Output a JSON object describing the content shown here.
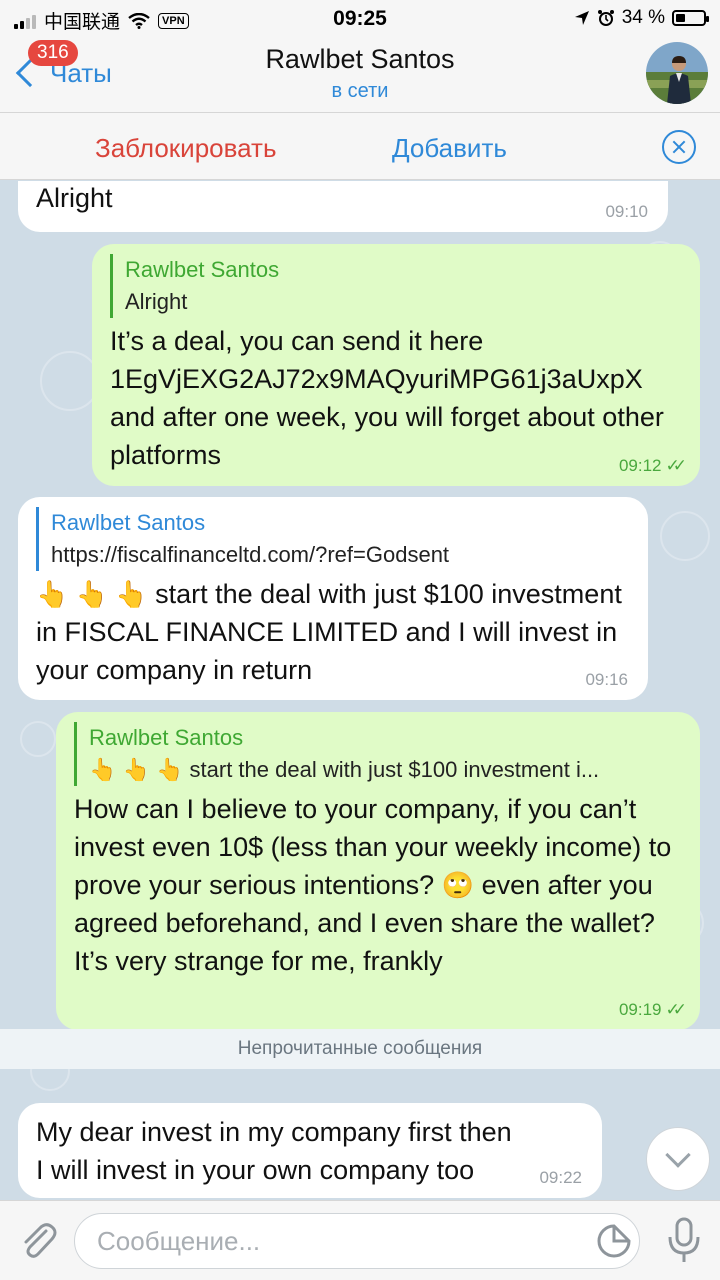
{
  "status_bar": {
    "carrier": "中国联通",
    "vpn": "VPN",
    "time": "09:25",
    "battery": "34 %",
    "battery_level": 0.34
  },
  "header": {
    "back_label": "Чаты",
    "unread_badge": "316",
    "title": "Rawlbet Santos",
    "subtitle": "в сети"
  },
  "actions": {
    "block": "Заблокировать",
    "add": "Добавить"
  },
  "messages": [
    {
      "direction": "in",
      "text": "Alright",
      "time": "09:10"
    },
    {
      "direction": "out",
      "reply_name": "Rawlbet Santos",
      "reply_text": "Alright",
      "text": "It’s a deal, you can send it here 1EgVjEXG2AJ72x9MAQyuriMPG61j3aUxpX and after one week, you will forget about other platforms",
      "time": "09:12"
    },
    {
      "direction": "in",
      "reply_name": "Rawlbet Santos",
      "reply_text": "https://fiscalfinanceltd.com/?ref=Godsent",
      "emoji": "👆 👆 👆",
      "text": " start the deal with just $100 investment in FISCAL FINANCE LIMITED and I will invest in your company in return",
      "time": "09:16"
    },
    {
      "direction": "out",
      "reply_name": "Rawlbet Santos",
      "reply_text": "👆 👆 👆  start the deal with just $100 investment i...",
      "text": "How can I believe to your company, if you can’t invest even 10$ (less than your weekly income) to prove your serious intentions? ",
      "emoji2": "🙄",
      "text2": " even after you agreed beforehand, and I even share the wallet? It’s very strange for me, frankly",
      "time": "09:19"
    },
    {
      "direction": "in",
      "text": "My dear invest in my company first then I will invest in your own company too",
      "time": "09:22"
    }
  ],
  "unread_divider": "Непрочитанные сообщения",
  "input": {
    "placeholder": "Сообщение...",
    "value": ""
  },
  "colors": {
    "accent": "#2f89d8",
    "danger": "#d9443a",
    "outgoing_bubble": "#e0fbc7",
    "incoming_bubble": "#ffffff",
    "chat_background": "#cfdce6",
    "badge": "#e6473f"
  },
  "icons": [
    "back-chevron-icon",
    "close-circle-icon",
    "attach-paperclip-icon",
    "sticker-icon",
    "microphone-icon",
    "scroll-down-chevron-icon",
    "read-checkmarks-icon"
  ]
}
